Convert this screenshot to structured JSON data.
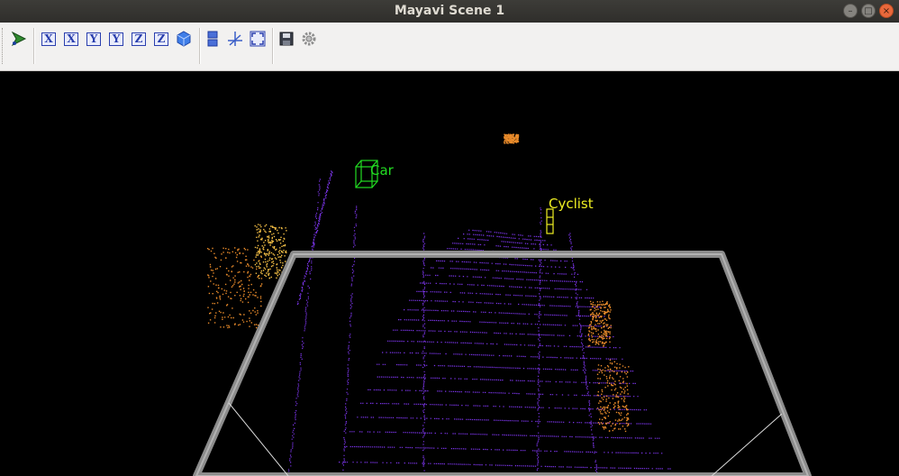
{
  "window": {
    "title": "Mayavi Scene 1"
  },
  "window_buttons": [
    {
      "name": "minimize-button",
      "glyph": "–"
    },
    {
      "name": "maximize-button",
      "glyph": "□"
    },
    {
      "name": "close-button",
      "glyph": "×"
    }
  ],
  "toolbar": {
    "pipeline_icon": "mayavi-pipeline-icon",
    "view_buttons": [
      "X",
      "X",
      "Y",
      "Y",
      "Z",
      "Z"
    ],
    "isometric_icon": "isometric-cube-icon",
    "parallel_icon": "parallel-projection-icon",
    "axes_icon": "axes-toggle-icon",
    "fullscreen_icon": "fullscreen-icon",
    "save_icon": "save-icon",
    "configure_icon": "gear-icon"
  },
  "scene": {
    "labels": [
      {
        "text": "Car",
        "color": "#22dd22"
      },
      {
        "text": "Cyclist",
        "color": "#eeee22"
      }
    ],
    "colors": {
      "ground_points": "#7a34e8",
      "warm_points": "#e88a2a",
      "hot_points": "#f5c046",
      "grid_frame": "#8c8c8c",
      "car_box": "#22dd22",
      "cyclist_box": "#eeee22"
    }
  }
}
